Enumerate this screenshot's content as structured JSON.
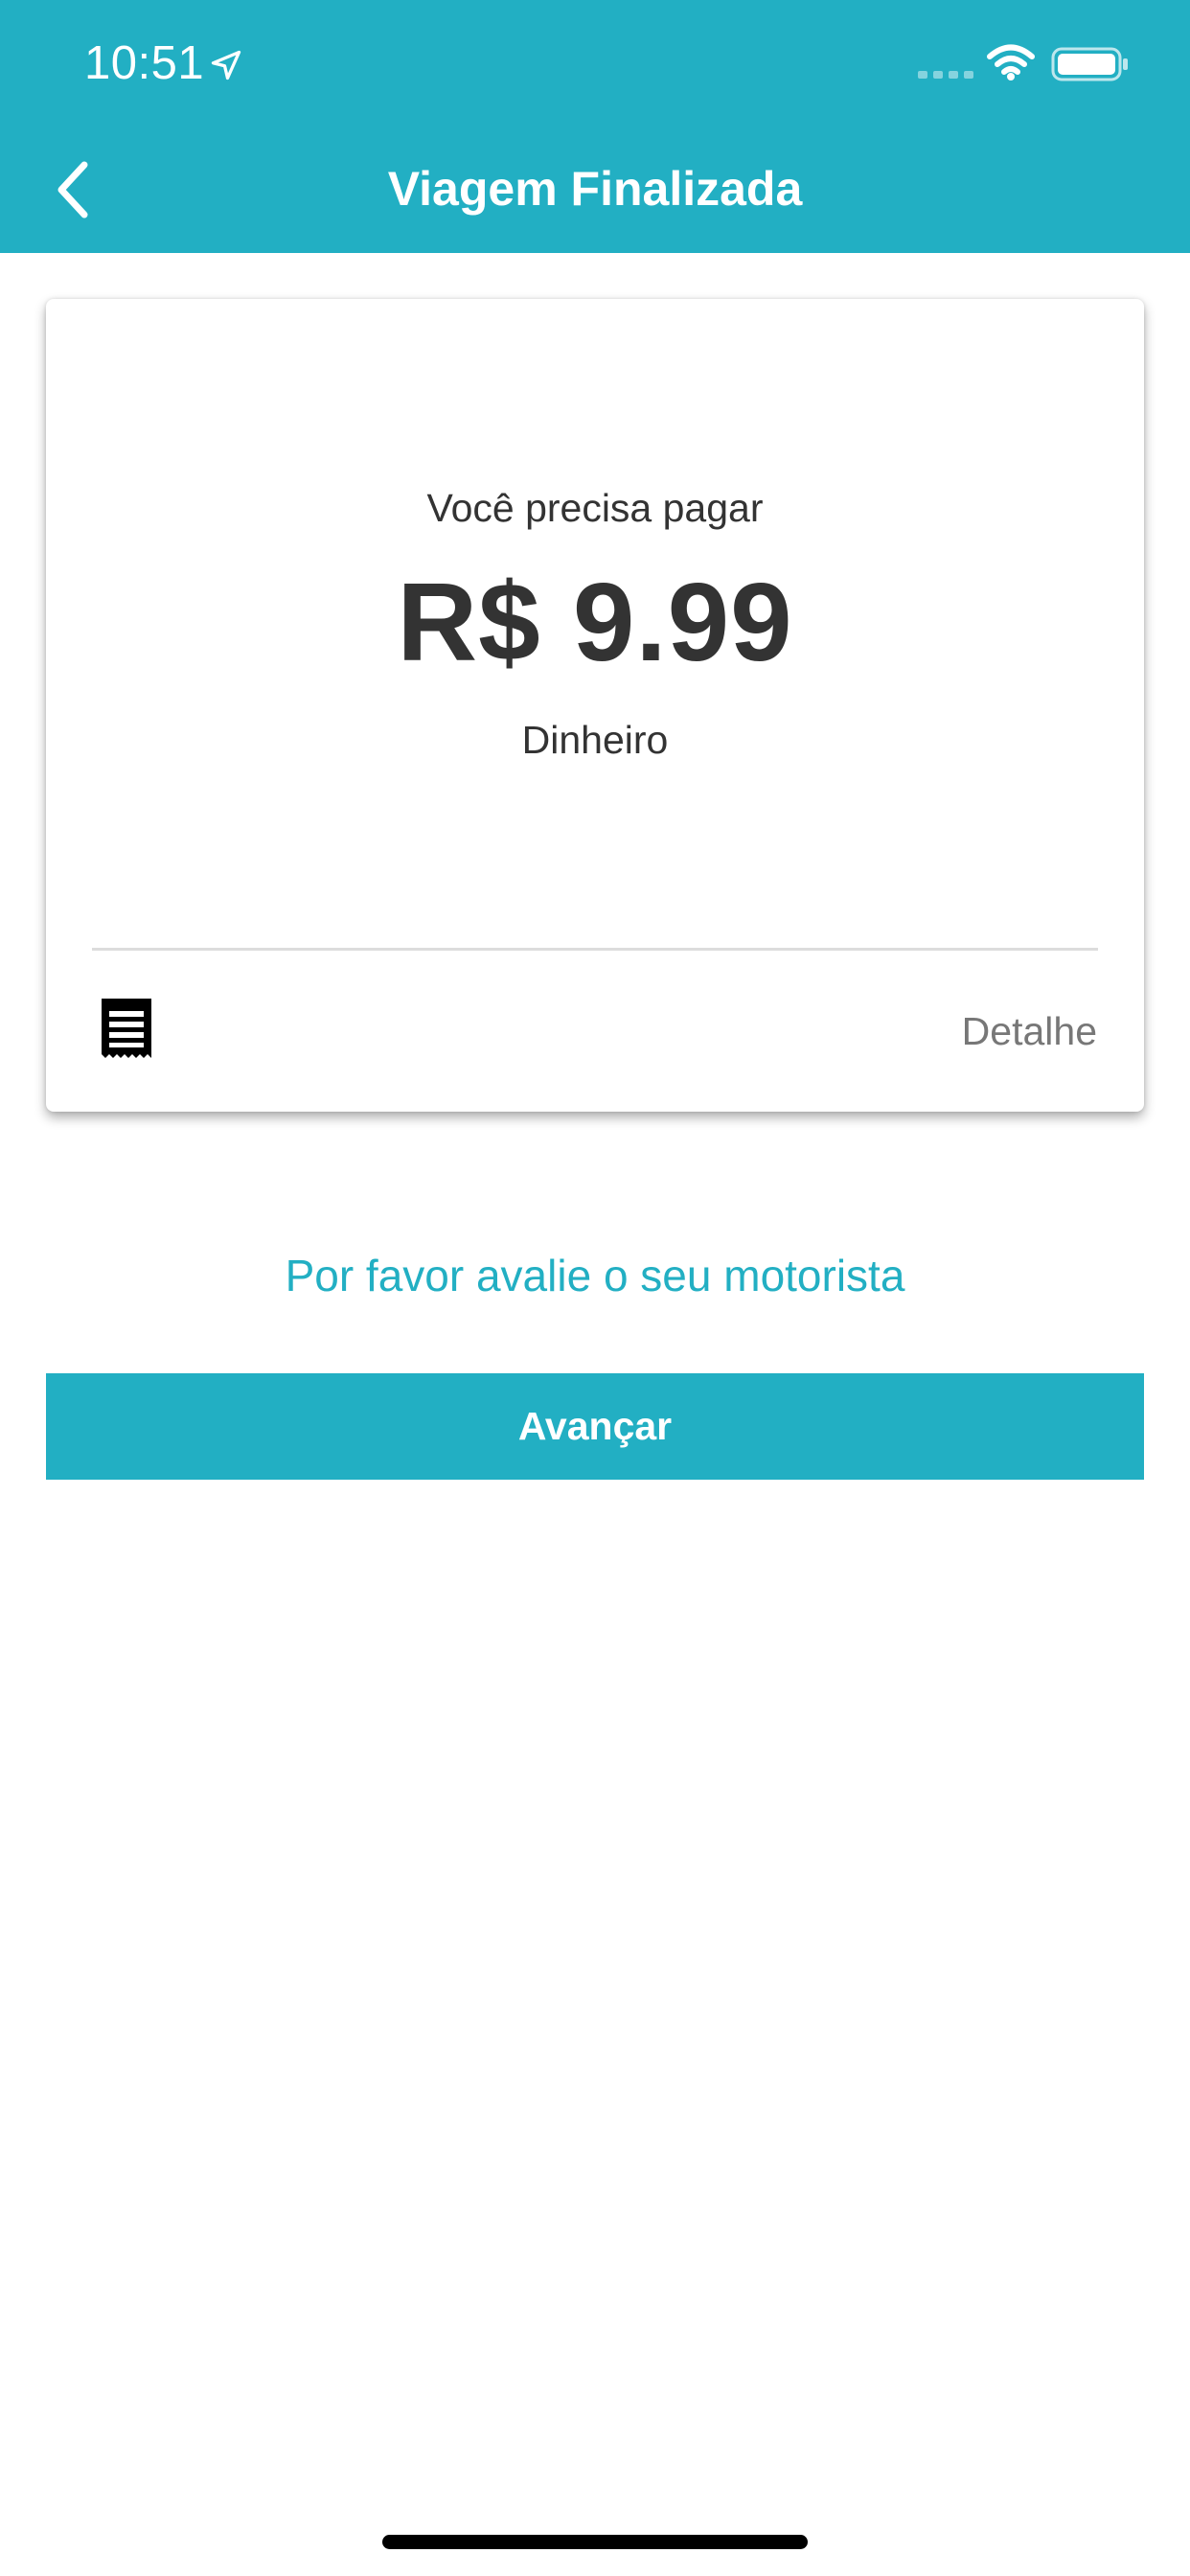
{
  "status_bar": {
    "time": "10:51",
    "location_icon": "location-arrow-icon",
    "signal_icon": "cellular-signal-icon",
    "wifi_icon": "wifi-icon",
    "battery_icon": "battery-icon"
  },
  "header": {
    "back_icon": "chevron-left-icon",
    "title": "Viagem Finalizada",
    "background_color": "#22afc3"
  },
  "payment_card": {
    "label": "Você precisa pagar",
    "amount": "R$ 9.99",
    "method": "Dinheiro",
    "receipt_icon": "receipt-icon",
    "detail_label": "Detalhe"
  },
  "rating": {
    "link_text": "Por favor avalie o seu motorista"
  },
  "actions": {
    "next_label": "Avançar"
  },
  "colors": {
    "accent": "#22afc3",
    "text_primary": "#333333",
    "text_secondary": "#777777"
  }
}
